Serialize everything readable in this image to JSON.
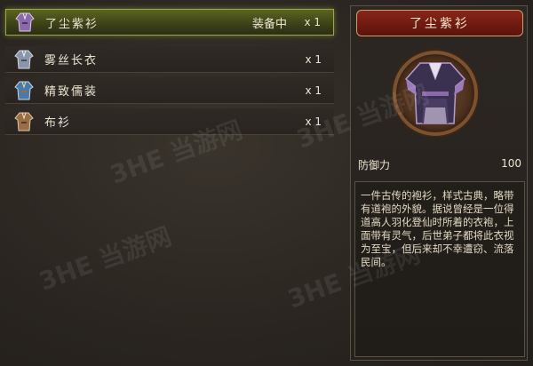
{
  "items": [
    {
      "name": "了尘紫衫",
      "status": "装备中",
      "qty": "x 1",
      "icon": "purple-robe-icon",
      "selected": true
    },
    {
      "name": "雾丝长衣",
      "status": "",
      "qty": "x 1",
      "icon": "grey-robe-icon",
      "selected": false
    },
    {
      "name": "精致儒装",
      "status": "",
      "qty": "x 1",
      "icon": "blue-robe-icon",
      "selected": false
    },
    {
      "name": "布衫",
      "status": "",
      "qty": "x 1",
      "icon": "brown-shirt-icon",
      "selected": false
    }
  ],
  "detail": {
    "title": "了尘紫衫",
    "portrait_icon": "purple-robe-icon",
    "stat_label": "防御力",
    "stat_value": "100",
    "description": "一件古传的袍衫，样式古典，略带有道袍的外貌。据说曾经是一位得道高人羽化登仙时所着的衣袍，上面带有灵气，后世弟子都将此衣视为至宝，但后来却不幸遭窃、流落民间。"
  },
  "watermark": "3HE 当游网",
  "colors": {
    "selected_highlight": "#9aa84a",
    "title_bg": "#8a2418",
    "border_gold": "#c9a066"
  }
}
